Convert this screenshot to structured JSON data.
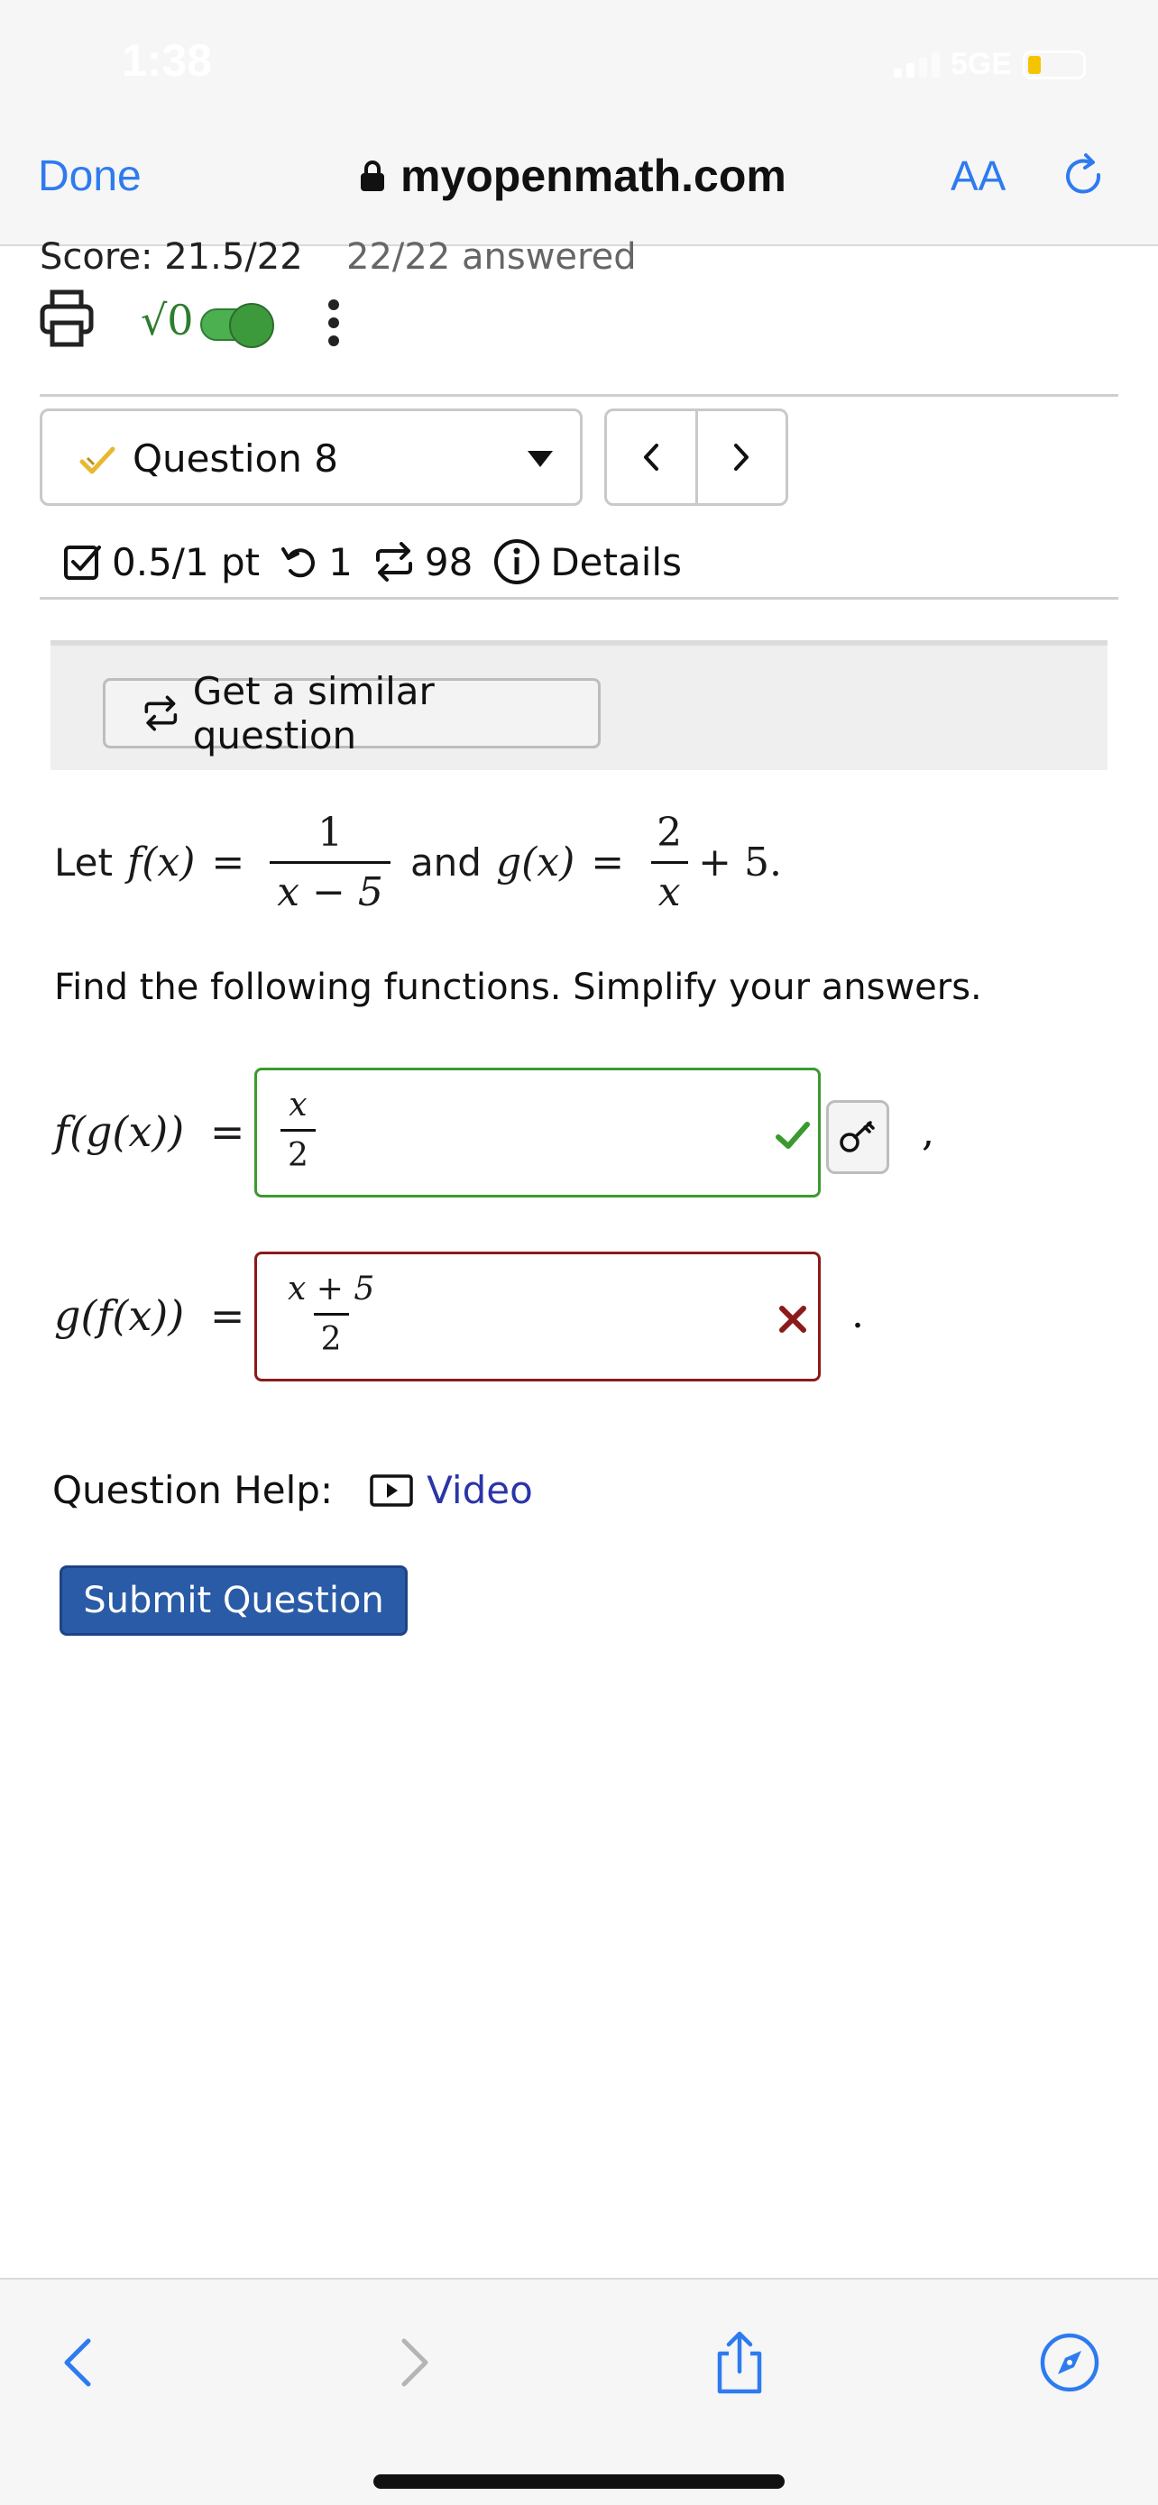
{
  "status_bar": {
    "time": "1:38",
    "network": "5GE"
  },
  "browser": {
    "done_label": "Done",
    "domain": "myopenmath.com",
    "text_size_label": "AA"
  },
  "page": {
    "score": "Score: 21.5/22",
    "answered": "22/22 answered",
    "question_select": "Question 8",
    "points": "0.5/1 pt",
    "retries": "1",
    "versions": "98",
    "details_label": "Details",
    "similar_label": "Get a similar question",
    "problem": {
      "let": "Let",
      "and": "and",
      "f_name": "f(x)",
      "f_num": "1",
      "f_den": "x − 5",
      "g_name": "g(x)",
      "g_num": "2",
      "g_den": "x",
      "g_tail": "+ 5."
    },
    "instructions": "Find the following functions. Simplify your answers.",
    "answers": [
      {
        "label": "f(g(x))",
        "eq": "=",
        "num": "x",
        "den": "2",
        "status": "correct",
        "punct": ","
      },
      {
        "label": "g(f(x))",
        "eq": "=",
        "num": "x + 5",
        "den": "2",
        "status": "incorrect",
        "punct": "."
      }
    ],
    "help_label": "Question Help:",
    "video_label": "Video",
    "submit_label": "Submit Question"
  },
  "colors": {
    "accent_blue": "#2e7bf0",
    "correct_green": "#3b9a2e",
    "incorrect_red": "#8b1a1a",
    "submit_blue": "#2a5ba6",
    "link_blue": "#2a35a8"
  },
  "icons": [
    "print-icon",
    "sqrt-icon",
    "kebab-menu-icon",
    "check-icon",
    "chevron-left-icon",
    "chevron-right-icon",
    "checkbox-icon",
    "retry-icon",
    "repeat-icon",
    "info-icon",
    "key-icon",
    "video-icon",
    "share-icon",
    "compass-icon",
    "reload-icon",
    "lock-icon"
  ]
}
